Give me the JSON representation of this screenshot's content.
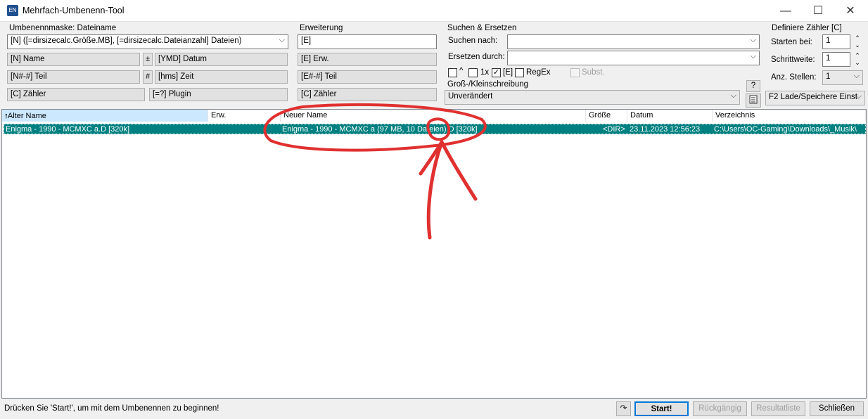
{
  "window": {
    "title": "Mehrfach-Umbenenn-Tool",
    "icon_label": "EN",
    "controls": [
      "—",
      "☐",
      "✕"
    ]
  },
  "mask": {
    "label": "Umbenennmaske: Dateiname",
    "value": "[N] ([=dirsizecalc.Größe.MB], [=dirsizecalc.Dateianzahl] Dateien)",
    "buttons": [
      "[N]  Name",
      "[YMD]  Datum",
      "[N#-#] Teil",
      "[hms]  Zeit",
      "[C]  Zähler",
      "[=?]  Plugin"
    ],
    "mini_buttons": [
      "±",
      "#"
    ]
  },
  "ext": {
    "label": "Erweiterung",
    "value": "[E]",
    "buttons": [
      "[E]  Erw.",
      "[E#-#] Teil",
      "[C]  Zähler"
    ]
  },
  "search": {
    "group_label": "Suchen & Ersetzen",
    "find_label": "Suchen nach:",
    "replace_label": "Ersetzen durch:",
    "find_value": "",
    "replace_value": "",
    "opt1_label": "^",
    "opt2_label": "1x",
    "opt3_label": "[E]",
    "opt4_label": "RegEx",
    "opt5_label": "Subst.",
    "opt3_checked": "✓"
  },
  "case": {
    "label": "Groß-/Kleinschreibung",
    "value": "Unverändert",
    "help": "?"
  },
  "counter": {
    "label": "Definiere Zähler [C]",
    "start_label": "Starten bei:",
    "start_value": "1",
    "step_label": "Schrittweite:",
    "step_value": "1",
    "digits_label": "Anz. Stellen:",
    "digits_value": "1",
    "load_save": "F2 Lade/Speichere Einst"
  },
  "columns": [
    "Alter Name",
    "Erw.",
    "Neuer Name",
    "Größe",
    "Datum",
    "Verzeichnis"
  ],
  "sort_arrow": "🠕",
  "rows": [
    {
      "old": "Enigma - 1990 - MCMXC a.D  [320k]",
      "ext": "",
      "new": "Enigma - 1990 - MCMXC a (97 MB, 10 Dateien).D  [320k]",
      "size": "<DIR>",
      "date": "23.11.2023 12:56:23",
      "dir": "C:\\Users\\OC-Gaming\\Downloads\\_Musik\\"
    }
  ],
  "status": "Drücken Sie 'Start!', um mit dem Umbenennen zu beginnen!",
  "bottom": {
    "undo_icon": "↷",
    "start": "Start!",
    "undo": "Rückgängig",
    "results": "Resultatliste",
    "close": "Schließen"
  },
  "colors": {
    "selection": "#008080",
    "header_sort": "#cce8ff",
    "annotation": "#e03030"
  }
}
